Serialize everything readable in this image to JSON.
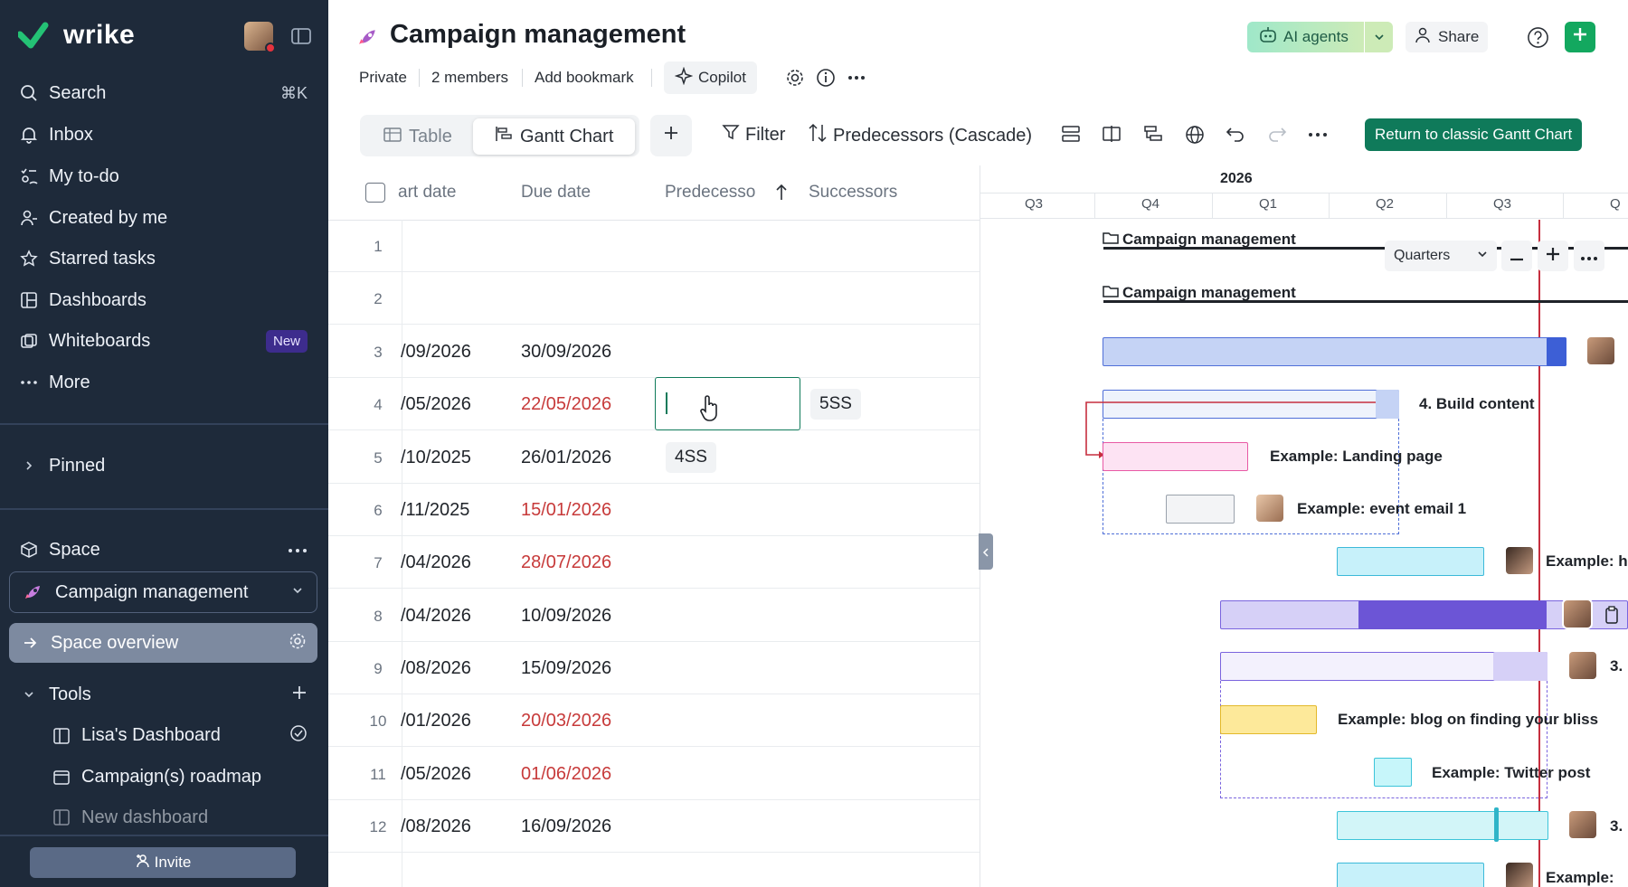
{
  "app": {
    "logo": "wrike"
  },
  "sidebar": {
    "search": {
      "label": "Search",
      "shortcut": "⌘K"
    },
    "nav": [
      {
        "label": "Inbox"
      },
      {
        "label": "My to-do"
      },
      {
        "label": "Created by me"
      },
      {
        "label": "Starred tasks"
      },
      {
        "label": "Dashboards"
      },
      {
        "label": "Whiteboards",
        "badge": "New"
      },
      {
        "label": "More"
      }
    ],
    "pinned": "Pinned",
    "space": {
      "label": "Space",
      "selected": "Campaign management"
    },
    "overview": "Space overview",
    "tools": {
      "label": "Tools",
      "items": [
        "Lisa's Dashboard",
        "Campaign(s) roadmap",
        "New dashboard"
      ]
    },
    "invite": "Invite"
  },
  "header": {
    "title": "Campaign management",
    "privacy": "Private",
    "members": "2 members",
    "bookmark": "Add bookmark",
    "copilot": "Copilot",
    "ai_agents": "AI agents",
    "share": "Share"
  },
  "toolbar": {
    "tabs": [
      {
        "label": "Table"
      },
      {
        "label": "Gantt Chart",
        "active": true
      }
    ],
    "filter": "Filter",
    "predecessors": "Predecessors (Cascade)",
    "return_button": "Return to classic Gantt Chart"
  },
  "table": {
    "columns": [
      "art date",
      "Due date",
      "Predecesso",
      "Successors"
    ],
    "rows": [
      {
        "n": "1",
        "start": "",
        "due": "",
        "due_overdue": false,
        "pred": "",
        "succ": ""
      },
      {
        "n": "2",
        "start": "",
        "due": "",
        "due_overdue": false,
        "pred": "",
        "succ": ""
      },
      {
        "n": "3",
        "start": "/09/2026",
        "due": "30/09/2026",
        "due_overdue": false,
        "pred": "",
        "succ": ""
      },
      {
        "n": "4",
        "start": "/05/2026",
        "due": "22/05/2026",
        "due_overdue": true,
        "pred": "",
        "succ": "5SS"
      },
      {
        "n": "5",
        "start": "/10/2025",
        "due": "26/01/2026",
        "due_overdue": false,
        "pred": "4SS",
        "succ": ""
      },
      {
        "n": "6",
        "start": "/11/2025",
        "due": "15/01/2026",
        "due_overdue": true,
        "pred": "",
        "succ": ""
      },
      {
        "n": "7",
        "start": "/04/2026",
        "due": "28/07/2026",
        "due_overdue": true,
        "pred": "",
        "succ": ""
      },
      {
        "n": "8",
        "start": "/04/2026",
        "due": "10/09/2026",
        "due_overdue": false,
        "pred": "",
        "succ": ""
      },
      {
        "n": "9",
        "start": "/08/2026",
        "due": "15/09/2026",
        "due_overdue": false,
        "pred": "",
        "succ": ""
      },
      {
        "n": "10",
        "start": "/01/2026",
        "due": "20/03/2026",
        "due_overdue": true,
        "pred": "",
        "succ": ""
      },
      {
        "n": "11",
        "start": "/05/2026",
        "due": "01/06/2026",
        "due_overdue": true,
        "pred": "",
        "succ": ""
      },
      {
        "n": "12",
        "start": "/08/2026",
        "due": "16/09/2026",
        "due_overdue": false,
        "pred": "",
        "succ": ""
      }
    ]
  },
  "gantt": {
    "year": "2026",
    "quarters": [
      "Q3",
      "Q4",
      "Q1",
      "Q2",
      "Q3",
      "Q"
    ],
    "zoom": "Quarters",
    "labels": {
      "folder1": "Campaign management",
      "folder2": "Campaign management",
      "r4": "4. Build content",
      "r5": "Example: Landing page",
      "r6": "Example: event email 1",
      "r7": "Example: h",
      "r9": "3.",
      "r10": "Example: blog on finding your bliss",
      "r11": "Example: Twitter post",
      "r12": "3.",
      "r13": "Example:"
    }
  },
  "colors": {
    "sidebar_bg": "#1e2a3a",
    "accent": "#0f7a5a",
    "badge": "#3d2c8d",
    "overdue": "#c73a3a"
  }
}
